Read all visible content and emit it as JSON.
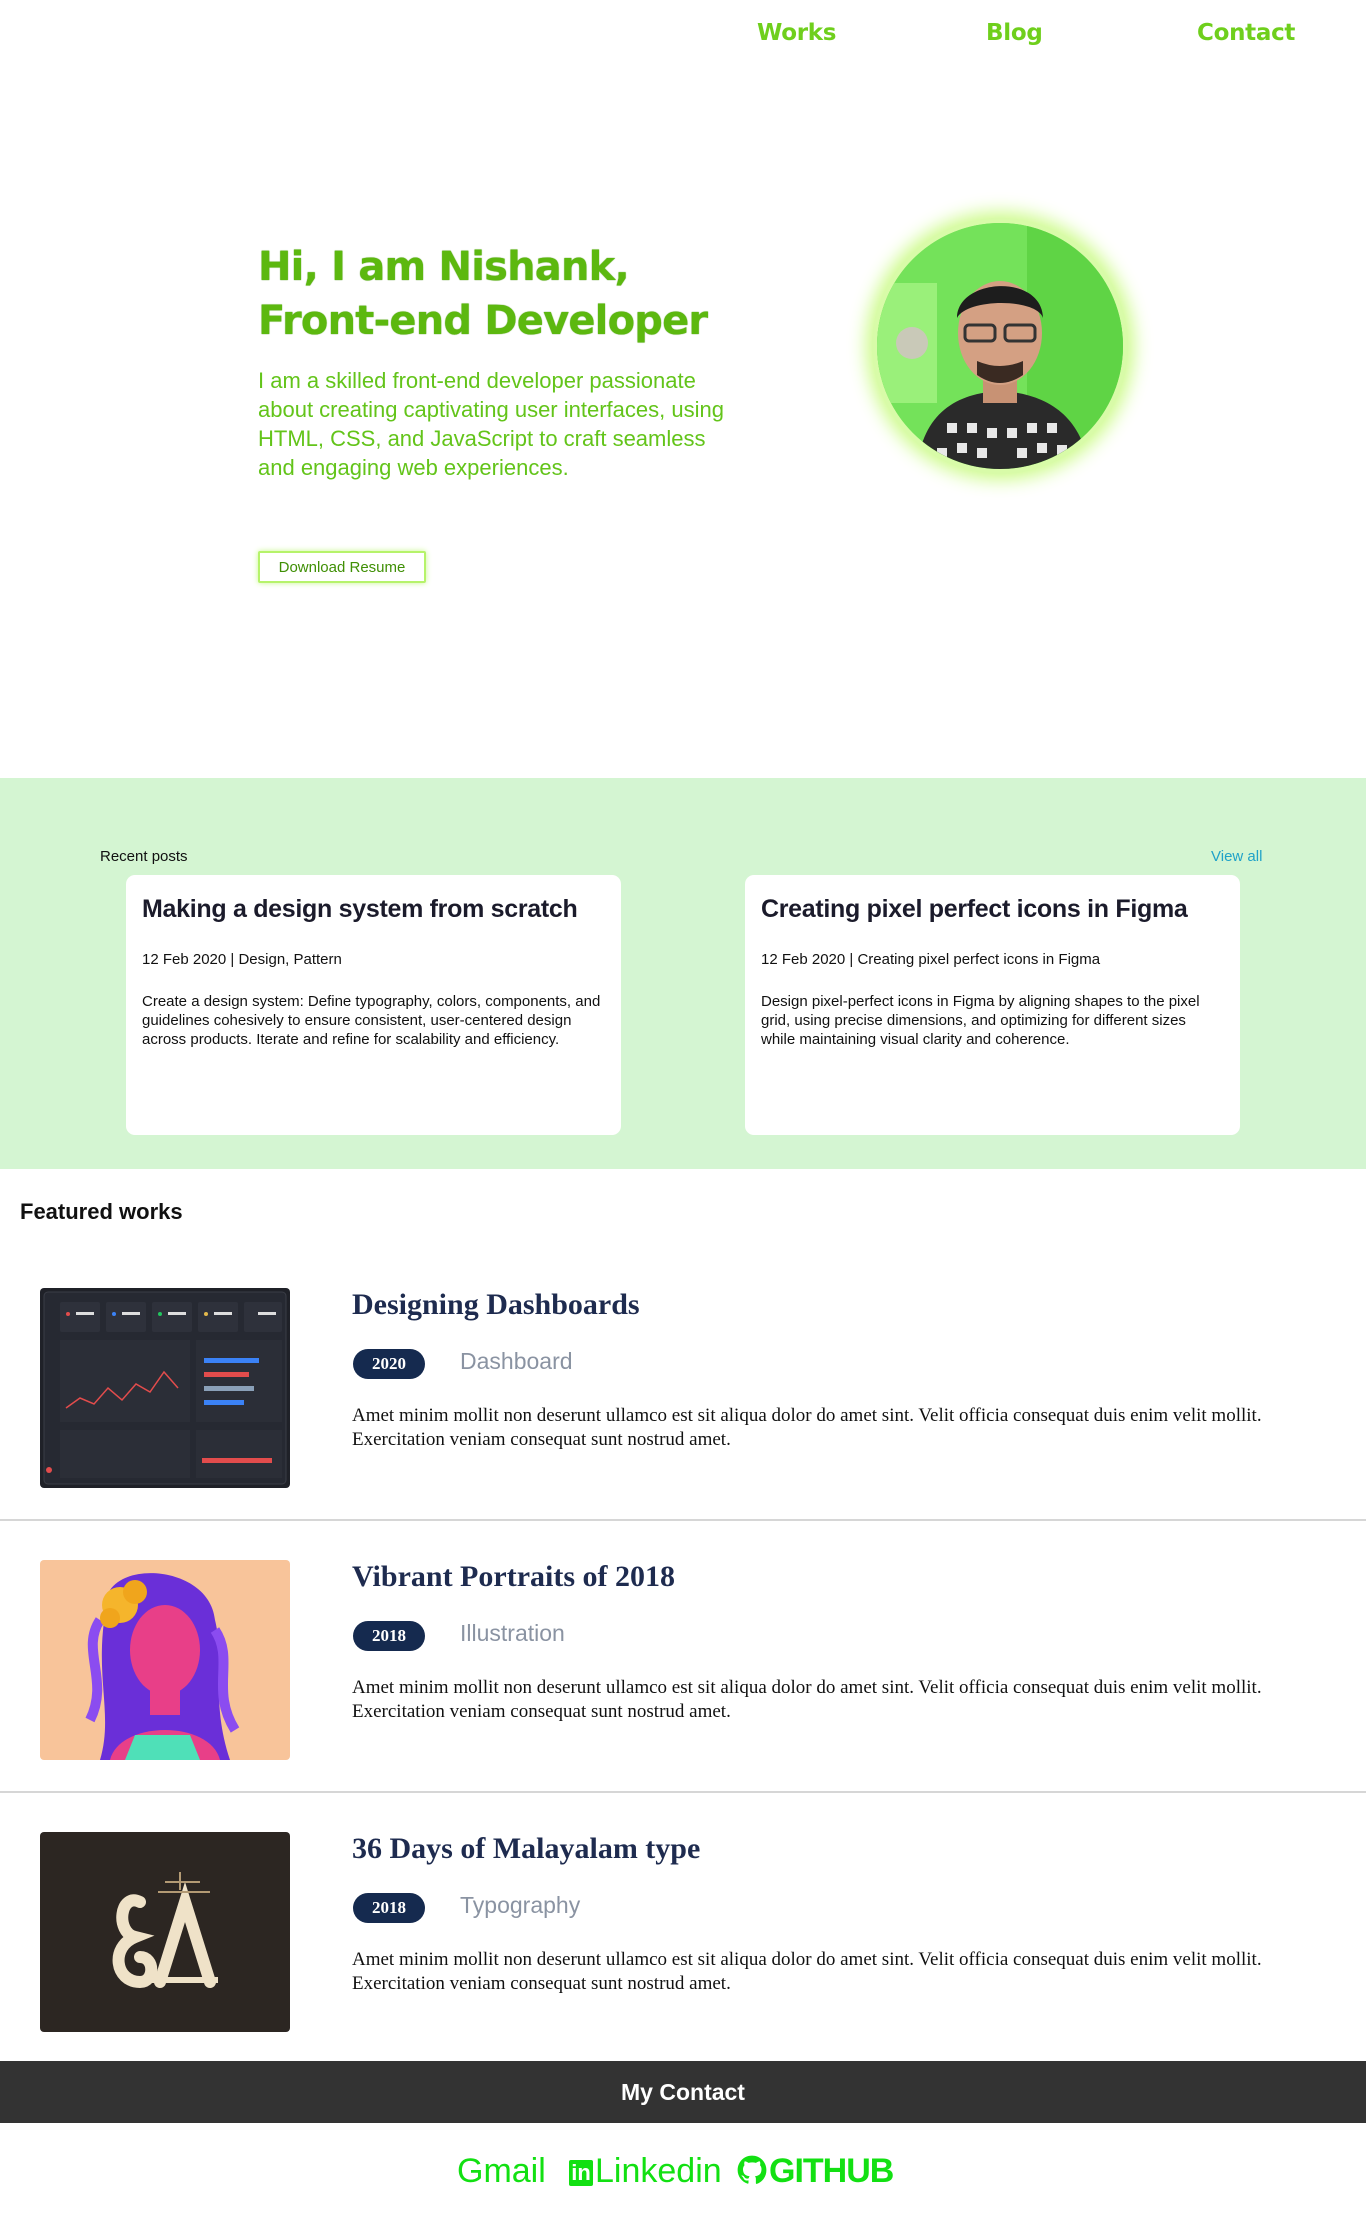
{
  "nav": {
    "works": "Works",
    "blog": "Blog",
    "contact": "Contact"
  },
  "hero": {
    "title_line1": "Hi, I am Nishank,",
    "title_line2": "Front-end Developer",
    "description": "I am a skilled front-end developer passionate about creating captivating user interfaces, using HTML, CSS, and JavaScript to craft seamless and engaging web experiences.",
    "resume_button": "Download Resume"
  },
  "recent_posts": {
    "label": "Recent posts",
    "view_all": "View all",
    "posts": [
      {
        "title": "Making a design system from scratch",
        "meta": "12 Feb 2020 | Design, Pattern",
        "excerpt": "Create a design system: Define typography, colors, components, and guidelines cohesively to ensure consistent, user-centered design across products. Iterate and refine for scalability and efficiency."
      },
      {
        "title": "Creating pixel perfect icons in Figma",
        "meta": "12 Feb 2020 | Creating pixel perfect icons in Figma",
        "excerpt": "Design pixel-perfect icons in Figma by aligning shapes to the pixel grid, using precise dimensions, and optimizing for different sizes while maintaining visual clarity and coherence."
      }
    ]
  },
  "featured": {
    "title": "Featured works",
    "works": [
      {
        "title": "Designing Dashboards",
        "year": "2020",
        "category": "Dashboard",
        "description": "Amet minim mollit non deserunt ullamco est sit aliqua dolor do amet sint. Velit officia consequat duis enim velit mollit. Exercitation veniam consequat sunt nostrud amet."
      },
      {
        "title": "Vibrant Portraits of 2018",
        "year": "2018",
        "category": "Illustration",
        "description": "Amet minim mollit non deserunt ullamco est sit aliqua dolor do amet sint. Velit officia consequat duis enim velit mollit. Exercitation veniam consequat sunt nostrud amet."
      },
      {
        "title": "36 Days of Malayalam type",
        "year": "2018",
        "category": "Typography",
        "description": "Amet minim mollit non deserunt ullamco est sit aliqua dolor do amet sint. Velit officia consequat duis enim velit mollit. Exercitation veniam consequat sunt nostrud amet."
      }
    ]
  },
  "contact": {
    "heading": "My Contact",
    "gmail": "Gmail",
    "linkedin": "Linkedin",
    "linkedin_badge": "in",
    "github": "GITHUB"
  },
  "colors": {
    "accent_green": "#6fcf1c",
    "posts_bg": "#d4f5d2",
    "navy": "#152a4f",
    "contact_bar": "#333333",
    "social_green": "#12e012"
  }
}
